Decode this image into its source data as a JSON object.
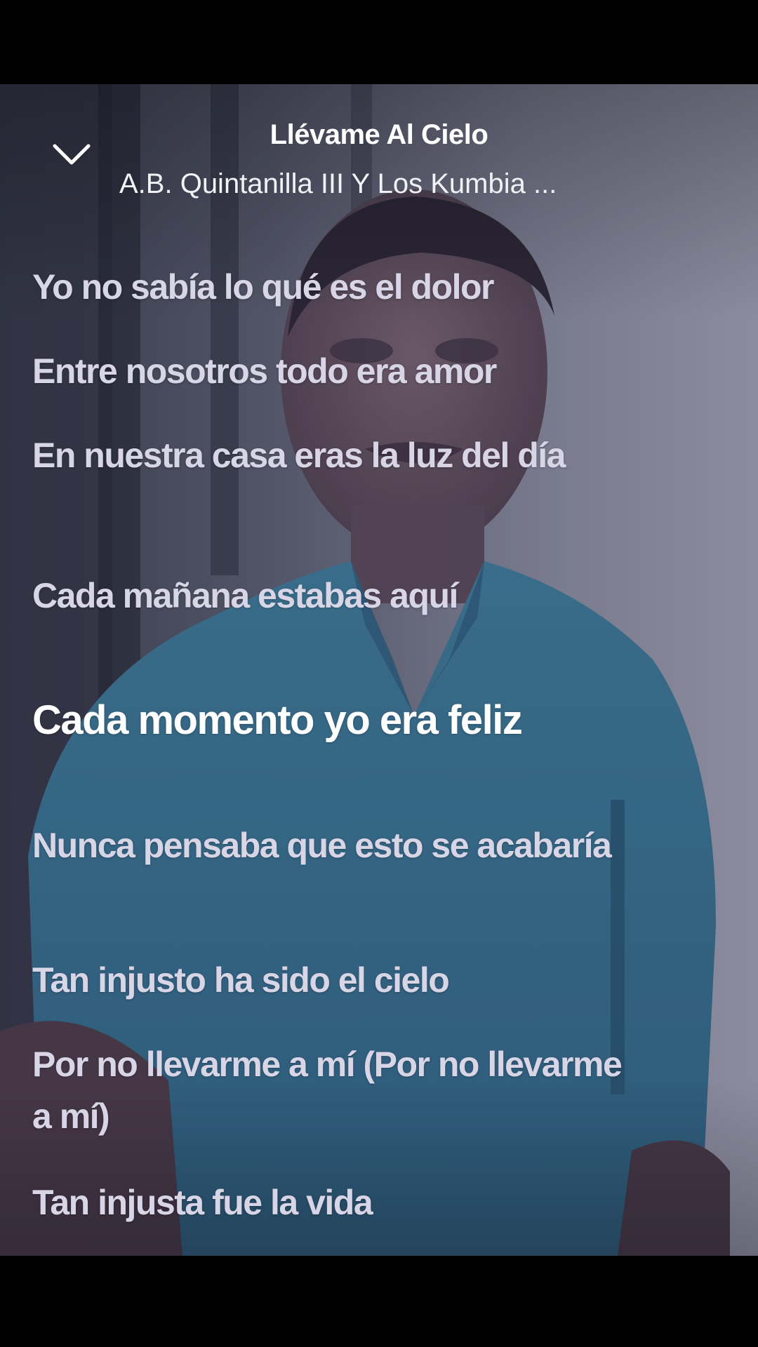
{
  "player": {
    "track_title": "Llévame Al Cielo",
    "artist": "A.B. Quintanilla III Y Los Kumbia ..."
  },
  "icons": {
    "collapse": "chevron-down-icon"
  },
  "colors": {
    "lyric": "#d8d6e6",
    "active_lyric": "#ffffff",
    "background": "#000000"
  },
  "lyrics": [
    {
      "text": "Yo no sabía lo qué es el dolor"
    },
    {
      "text": "Entre nosotros todo era amor"
    },
    {
      "text": "En nuestra casa eras la luz del día"
    },
    {
      "text": "Cada mañana estabas aquí"
    },
    {
      "text": "Cada momento yo era feliz",
      "active": true
    },
    {
      "text": "Nunca pensaba que esto se acabaría"
    },
    {
      "text": "Tan injusto ha sido el cielo"
    },
    {
      "text": "Por no llevarme a mí (Por no llevarme a mí)"
    },
    {
      "text": "Tan injusta fue la vida"
    }
  ]
}
